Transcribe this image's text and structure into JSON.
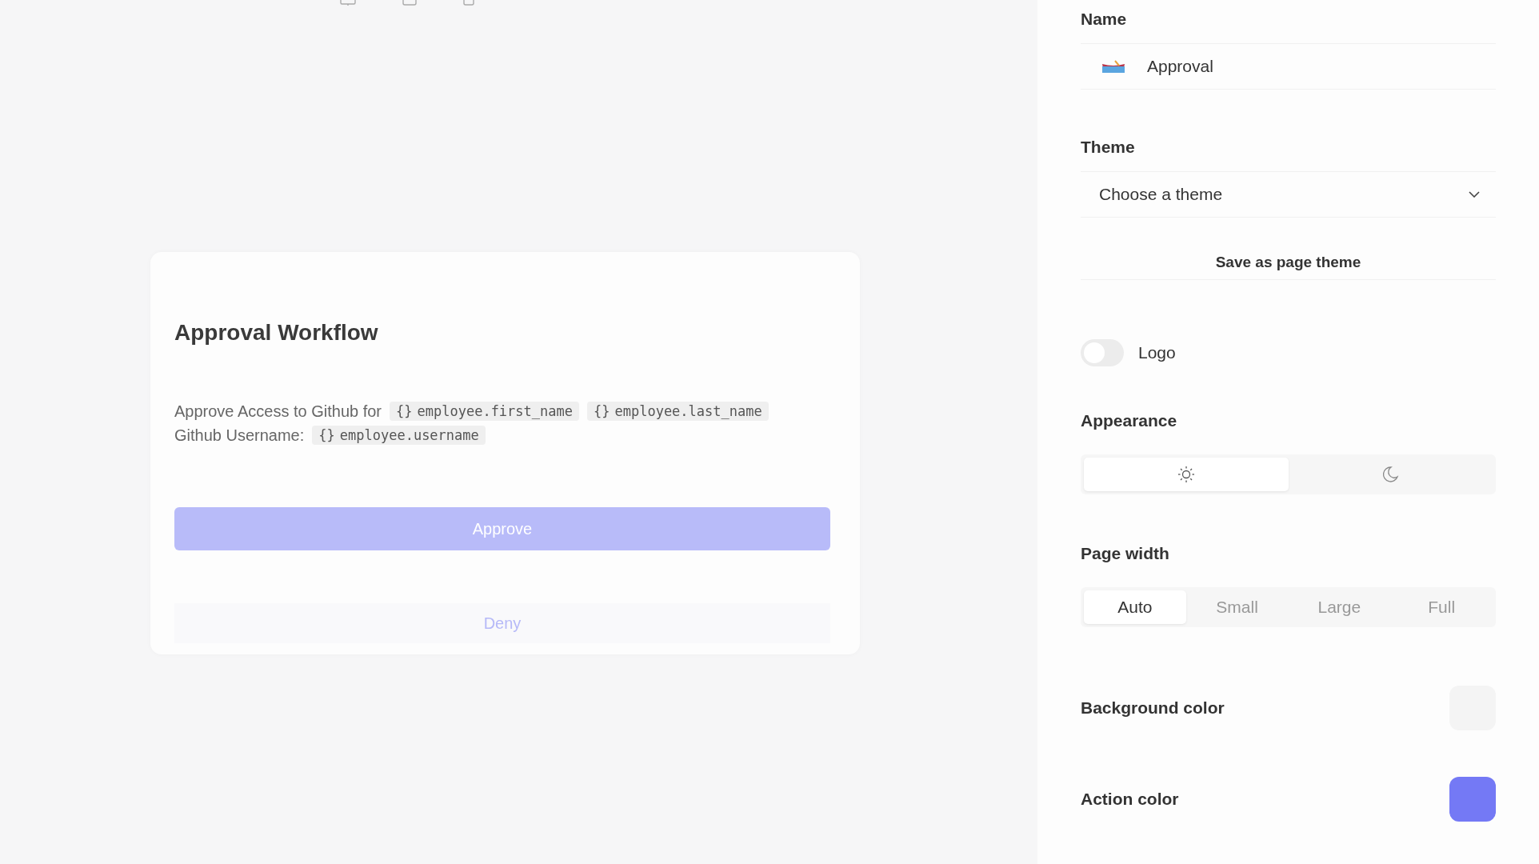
{
  "preview": {
    "title": "Approval Workflow",
    "lines": [
      {
        "text": "Approve Access to Github for",
        "variables": [
          {
            "prefix": "{}",
            "name": "employee.first_name"
          },
          {
            "prefix": "{}",
            "name": "employee.last_name"
          }
        ]
      },
      {
        "text": "Github Username:",
        "variables": [
          {
            "prefix": "{}",
            "name": "employee.username"
          }
        ]
      }
    ],
    "buttons": [
      {
        "kind": "primary",
        "label": "Approve"
      },
      {
        "kind": "secondary",
        "label": "Deny"
      }
    ]
  },
  "settings": {
    "name": {
      "label": "Name",
      "value": "Approval"
    },
    "theme": {
      "label": "Theme",
      "placeholder": "Choose a theme",
      "save_button": "Save as page theme"
    },
    "logo": {
      "label": "Logo",
      "on": false
    },
    "appearance": {
      "label": "Appearance",
      "options": [
        {
          "kind": "light",
          "selected": true
        },
        {
          "kind": "dark",
          "selected": false
        }
      ]
    },
    "page_width": {
      "label": "Page width",
      "options": [
        {
          "label": "Auto",
          "selected": true
        },
        {
          "label": "Small",
          "selected": false
        },
        {
          "label": "Large",
          "selected": false
        },
        {
          "label": "Full",
          "selected": false
        }
      ]
    },
    "background_color": {
      "label": "Background color",
      "color": "#f4f4f4"
    },
    "action_color": {
      "label": "Action color",
      "color": "#7479f5"
    }
  }
}
